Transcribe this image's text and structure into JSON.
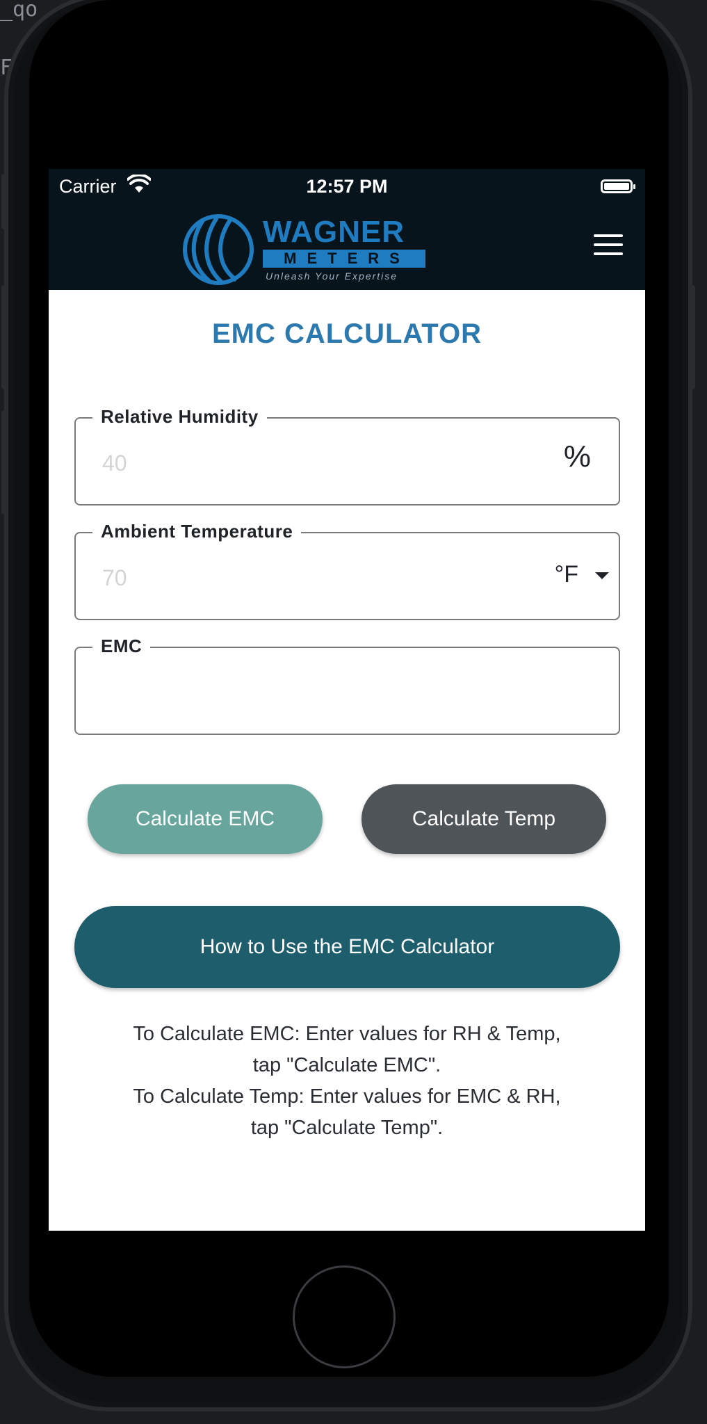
{
  "status_bar": {
    "carrier": "Carrier",
    "time": "12:57 PM"
  },
  "header": {
    "logo": {
      "brand_top": "WAGNER",
      "brand_bottom": "METERS",
      "tagline": "Unleash Your Expertise"
    },
    "menu_icon": "hamburger-menu-icon"
  },
  "page": {
    "title": "EMC CALCULATOR"
  },
  "fields": {
    "relative_humidity": {
      "label": "Relative Humidity",
      "placeholder": "40",
      "unit": "%"
    },
    "ambient_temperature": {
      "label": "Ambient Temperature",
      "placeholder": "70",
      "unit": "°F"
    },
    "emc": {
      "label": "EMC",
      "placeholder": ""
    }
  },
  "buttons": {
    "calculate_emc": "Calculate EMC",
    "calculate_temp": "Calculate Temp",
    "how_to": "How to Use the EMC Calculator"
  },
  "instructions": {
    "line1": "To Calculate EMC: Enter values for RH & Temp,",
    "line2": "tap \"Calculate EMC\".",
    "line3": "To Calculate Temp: Enter values for EMC & RH,",
    "line4": "tap \"Calculate Temp\"."
  },
  "colors": {
    "header_bg": "#07141b",
    "title_blue": "#2c79b0",
    "brand_blue": "#1f7cc1",
    "calc_emc_button": "#67a59d",
    "calc_temp_button": "#4f5459",
    "how_to_button": "#1e5d6b"
  }
}
